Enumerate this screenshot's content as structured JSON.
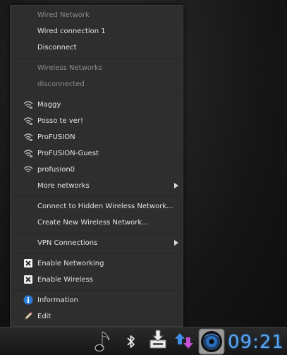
{
  "menu": {
    "wired_header": "Wired Network",
    "wired_connection": "Wired connection 1",
    "disconnect": "Disconnect",
    "wireless_header": "Wireless Networks",
    "wireless_status": "disconnected",
    "networks": [
      "Maggy",
      "Posso te ver!",
      "ProFUSION",
      "ProFUSION-Guest",
      "profusion0"
    ],
    "more_networks": "More networks",
    "connect_hidden": "Connect to Hidden Wireless Network...",
    "create_new": "Create New Wireless Network...",
    "vpn": "VPN Connections",
    "enable_networking": "Enable Networking",
    "enable_wireless": "Enable Wireless",
    "information": "Information",
    "edit": "Edit"
  },
  "panel": {
    "clock": "09:21",
    "icons": [
      "music-note-icon",
      "bluetooth-icon",
      "download-icon",
      "network-transfer-icon",
      "speaker-icon"
    ]
  },
  "colors": {
    "accent": "#5aa6f0",
    "menu_bg": "#2e2e2e",
    "info_blue": "#2a7fd4"
  }
}
